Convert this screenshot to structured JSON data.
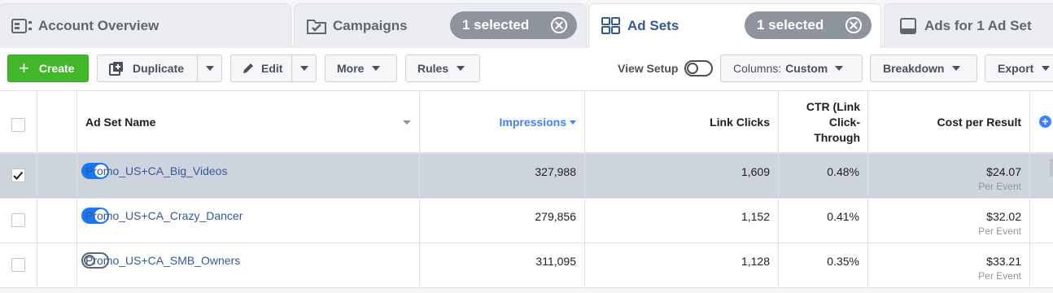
{
  "tabs": {
    "account_overview": "Account Overview",
    "campaigns": "Campaigns",
    "campaigns_selected": "1 selected",
    "ad_sets": "Ad Sets",
    "ad_sets_selected": "1 selected",
    "ads": "Ads for 1 Ad Set"
  },
  "toolbar": {
    "create": "Create",
    "duplicate": "Duplicate",
    "edit": "Edit",
    "more": "More",
    "rules": "Rules",
    "view_setup": "View Setup",
    "view_setup_on": false,
    "columns_prefix": "Columns:",
    "columns_value": "Custom",
    "breakdown": "Breakdown",
    "export": "Export"
  },
  "table": {
    "headers": {
      "name": "Ad Set Name",
      "impressions": "Impressions",
      "link_clicks": "Link Clicks",
      "ctr_lines": [
        "CTR (Link",
        "Click-",
        "Through"
      ],
      "cost": "Cost per Result"
    },
    "rows": [
      {
        "selected": true,
        "active": true,
        "name": "Promo_US+CA_Big_Videos",
        "impressions": "327,988",
        "link_clicks": "1,609",
        "ctr": "0.48%",
        "cost": "$24.07",
        "cost_sub": "Per Event"
      },
      {
        "selected": false,
        "active": true,
        "name": "Promo_US+CA_Crazy_Dancer",
        "impressions": "279,856",
        "link_clicks": "1,152",
        "ctr": "0.41%",
        "cost": "$32.02",
        "cost_sub": "Per Event"
      },
      {
        "selected": false,
        "active": false,
        "name": "Promo_US+CA_SMB_Owners",
        "impressions": "311,095",
        "link_clicks": "1,128",
        "ctr": "0.35%",
        "cost": "$33.21",
        "cost_sub": "Per Event"
      }
    ]
  },
  "colors": {
    "accent": "#365899",
    "create_green": "#42b72a",
    "toggle_on": "#1877f2",
    "selected_row": "#ced4de"
  }
}
